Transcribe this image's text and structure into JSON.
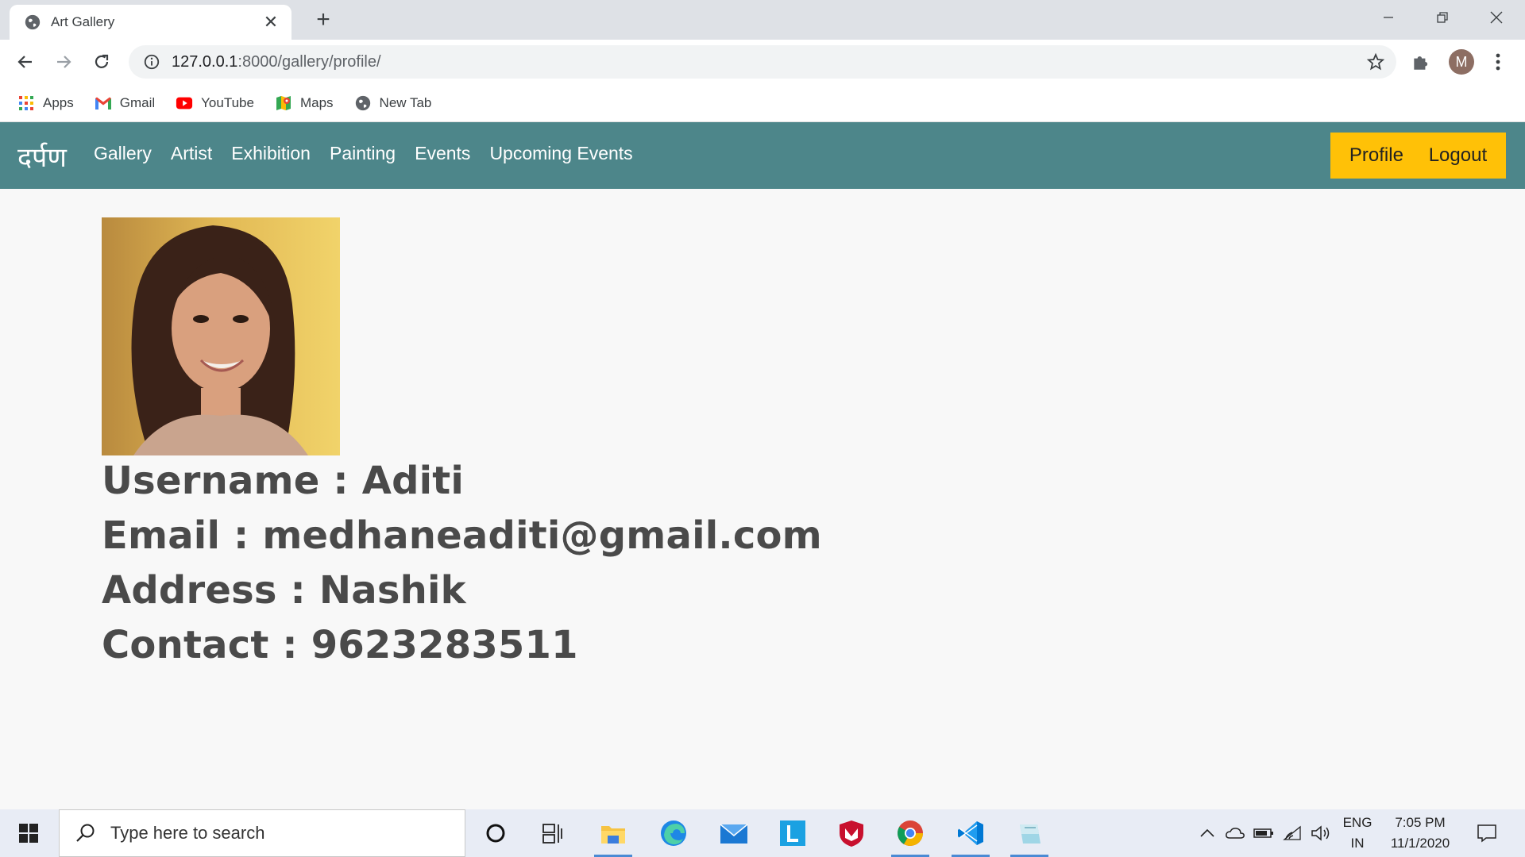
{
  "browser": {
    "tab_title": "Art Gallery",
    "url_host": "127.0.0.1",
    "url_path": ":8000/gallery/profile/",
    "avatar_letter": "M",
    "bookmarks": [
      {
        "label": "Apps",
        "icon": "apps-grid-icon"
      },
      {
        "label": "Gmail",
        "icon": "gmail-icon"
      },
      {
        "label": "YouTube",
        "icon": "youtube-icon"
      },
      {
        "label": "Maps",
        "icon": "maps-icon"
      },
      {
        "label": "New Tab",
        "icon": "globe-icon"
      }
    ]
  },
  "site": {
    "brand": "दर्पण",
    "nav_links": [
      "Gallery",
      "Artist",
      "Exhibition",
      "Painting",
      "Events",
      "Upcoming Events"
    ],
    "profile_label": "Profile",
    "logout_label": "Logout",
    "accent_color": "#4d868a",
    "button_color": "#ffc107"
  },
  "profile": {
    "username_line": "Username : Aditi",
    "email_line": "Email : medhaneaditi@gmail.com",
    "address_line": "Address : Nashik",
    "contact_line": "Contact : 9623283511"
  },
  "taskbar": {
    "search_placeholder": "Type here to search",
    "lang_top": "ENG",
    "lang_bottom": "IN",
    "time": "7:05 PM",
    "date": "11/1/2020"
  }
}
